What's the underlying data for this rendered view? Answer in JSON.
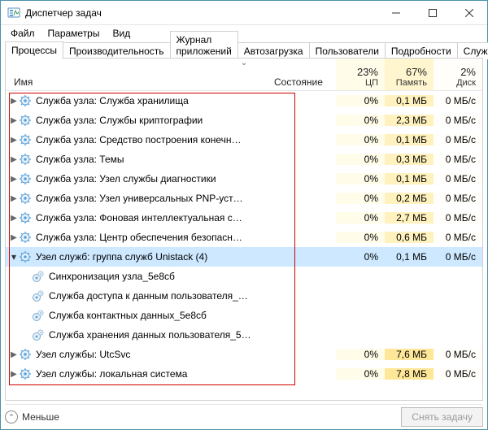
{
  "window": {
    "title": "Диспетчер задач"
  },
  "menu": {
    "file": "Файл",
    "options": "Параметры",
    "view": "Вид"
  },
  "tabs": {
    "processes": "Процессы",
    "performance": "Производительность",
    "apphistory": "Журнал приложений",
    "startup": "Автозагрузка",
    "users": "Пользователи",
    "details": "Подробности",
    "services": "Службы"
  },
  "columns": {
    "name": "Имя",
    "state": "Состояние",
    "cpu_pct": "23%",
    "cpu_label": "ЦП",
    "mem_pct": "67%",
    "mem_label": "Память",
    "disk_pct": "2%",
    "disk_label": "Диск"
  },
  "rows": [
    {
      "name": "Служба узла: Служба хранилища",
      "cpu": "0%",
      "mem": "0,1 МБ",
      "disk": "0 МБ/с",
      "type": "svc",
      "expand": ">"
    },
    {
      "name": "Служба узла: Службы криптографии",
      "cpu": "0%",
      "mem": "2,3 МБ",
      "disk": "0 МБ/с",
      "type": "svc",
      "expand": ">"
    },
    {
      "name": "Служба узла: Средство построения конечн…",
      "cpu": "0%",
      "mem": "0,1 МБ",
      "disk": "0 МБ/с",
      "type": "svc",
      "expand": ">"
    },
    {
      "name": "Служба узла: Темы",
      "cpu": "0%",
      "mem": "0,3 МБ",
      "disk": "0 МБ/с",
      "type": "svc",
      "expand": ">"
    },
    {
      "name": "Служба узла: Узел службы диагностики",
      "cpu": "0%",
      "mem": "0,1 МБ",
      "disk": "0 МБ/с",
      "type": "svc",
      "expand": ">"
    },
    {
      "name": "Служба узла: Узел универсальных PNP-уст…",
      "cpu": "0%",
      "mem": "0,2 МБ",
      "disk": "0 МБ/с",
      "type": "svc",
      "expand": ">"
    },
    {
      "name": "Служба узла: Фоновая интеллектуальная с…",
      "cpu": "0%",
      "mem": "2,7 МБ",
      "disk": "0 МБ/с",
      "type": "svc",
      "expand": ">"
    },
    {
      "name": "Служба узла: Центр обеспечения безопасн…",
      "cpu": "0%",
      "mem": "0,6 МБ",
      "disk": "0 МБ/с",
      "type": "svc",
      "expand": ">"
    },
    {
      "name": "Узел служб: группа служб Unistack (4)",
      "cpu": "0%",
      "mem": "0,1 МБ",
      "disk": "0 МБ/с",
      "type": "svc",
      "expand": "v",
      "selected": true
    },
    {
      "name": "Синхронизация узла_5e8cб",
      "type": "child"
    },
    {
      "name": "Служба доступа к данным пользователя_…",
      "type": "child"
    },
    {
      "name": "Служба контактных данных_5e8cб",
      "type": "child"
    },
    {
      "name": "Служба хранения данных пользователя_5…",
      "type": "child"
    },
    {
      "name": "Узел службы: UtcSvc",
      "cpu": "0%",
      "mem": "7,6 МБ",
      "disk": "0 МБ/с",
      "type": "svc",
      "expand": ">",
      "memdark": true
    },
    {
      "name": "Узел службы: локальная система",
      "cpu": "0%",
      "mem": "7,8 МБ",
      "disk": "0 МБ/с",
      "type": "svc",
      "expand": ">",
      "memdark": true
    }
  ],
  "footer": {
    "fewer": "Меньше",
    "end_task": "Снять задачу"
  }
}
